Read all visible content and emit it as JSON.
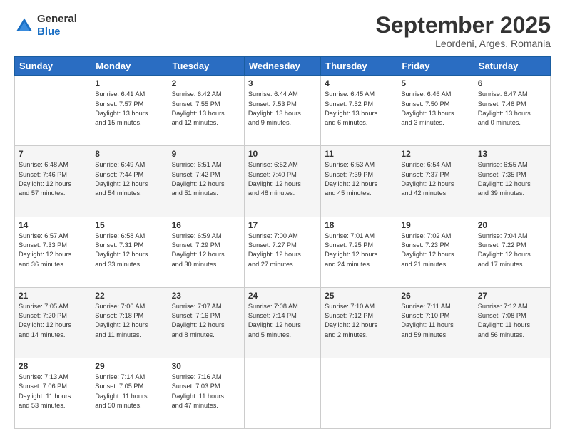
{
  "logo": {
    "general": "General",
    "blue": "Blue"
  },
  "header": {
    "title": "September 2025",
    "location": "Leordeni, Arges, Romania"
  },
  "days_of_week": [
    "Sunday",
    "Monday",
    "Tuesday",
    "Wednesday",
    "Thursday",
    "Friday",
    "Saturday"
  ],
  "weeks": [
    [
      {
        "day": "",
        "info": ""
      },
      {
        "day": "1",
        "info": "Sunrise: 6:41 AM\nSunset: 7:57 PM\nDaylight: 13 hours\nand 15 minutes."
      },
      {
        "day": "2",
        "info": "Sunrise: 6:42 AM\nSunset: 7:55 PM\nDaylight: 13 hours\nand 12 minutes."
      },
      {
        "day": "3",
        "info": "Sunrise: 6:44 AM\nSunset: 7:53 PM\nDaylight: 13 hours\nand 9 minutes."
      },
      {
        "day": "4",
        "info": "Sunrise: 6:45 AM\nSunset: 7:52 PM\nDaylight: 13 hours\nand 6 minutes."
      },
      {
        "day": "5",
        "info": "Sunrise: 6:46 AM\nSunset: 7:50 PM\nDaylight: 13 hours\nand 3 minutes."
      },
      {
        "day": "6",
        "info": "Sunrise: 6:47 AM\nSunset: 7:48 PM\nDaylight: 13 hours\nand 0 minutes."
      }
    ],
    [
      {
        "day": "7",
        "info": "Sunrise: 6:48 AM\nSunset: 7:46 PM\nDaylight: 12 hours\nand 57 minutes."
      },
      {
        "day": "8",
        "info": "Sunrise: 6:49 AM\nSunset: 7:44 PM\nDaylight: 12 hours\nand 54 minutes."
      },
      {
        "day": "9",
        "info": "Sunrise: 6:51 AM\nSunset: 7:42 PM\nDaylight: 12 hours\nand 51 minutes."
      },
      {
        "day": "10",
        "info": "Sunrise: 6:52 AM\nSunset: 7:40 PM\nDaylight: 12 hours\nand 48 minutes."
      },
      {
        "day": "11",
        "info": "Sunrise: 6:53 AM\nSunset: 7:39 PM\nDaylight: 12 hours\nand 45 minutes."
      },
      {
        "day": "12",
        "info": "Sunrise: 6:54 AM\nSunset: 7:37 PM\nDaylight: 12 hours\nand 42 minutes."
      },
      {
        "day": "13",
        "info": "Sunrise: 6:55 AM\nSunset: 7:35 PM\nDaylight: 12 hours\nand 39 minutes."
      }
    ],
    [
      {
        "day": "14",
        "info": "Sunrise: 6:57 AM\nSunset: 7:33 PM\nDaylight: 12 hours\nand 36 minutes."
      },
      {
        "day": "15",
        "info": "Sunrise: 6:58 AM\nSunset: 7:31 PM\nDaylight: 12 hours\nand 33 minutes."
      },
      {
        "day": "16",
        "info": "Sunrise: 6:59 AM\nSunset: 7:29 PM\nDaylight: 12 hours\nand 30 minutes."
      },
      {
        "day": "17",
        "info": "Sunrise: 7:00 AM\nSunset: 7:27 PM\nDaylight: 12 hours\nand 27 minutes."
      },
      {
        "day": "18",
        "info": "Sunrise: 7:01 AM\nSunset: 7:25 PM\nDaylight: 12 hours\nand 24 minutes."
      },
      {
        "day": "19",
        "info": "Sunrise: 7:02 AM\nSunset: 7:23 PM\nDaylight: 12 hours\nand 21 minutes."
      },
      {
        "day": "20",
        "info": "Sunrise: 7:04 AM\nSunset: 7:22 PM\nDaylight: 12 hours\nand 17 minutes."
      }
    ],
    [
      {
        "day": "21",
        "info": "Sunrise: 7:05 AM\nSunset: 7:20 PM\nDaylight: 12 hours\nand 14 minutes."
      },
      {
        "day": "22",
        "info": "Sunrise: 7:06 AM\nSunset: 7:18 PM\nDaylight: 12 hours\nand 11 minutes."
      },
      {
        "day": "23",
        "info": "Sunrise: 7:07 AM\nSunset: 7:16 PM\nDaylight: 12 hours\nand 8 minutes."
      },
      {
        "day": "24",
        "info": "Sunrise: 7:08 AM\nSunset: 7:14 PM\nDaylight: 12 hours\nand 5 minutes."
      },
      {
        "day": "25",
        "info": "Sunrise: 7:10 AM\nSunset: 7:12 PM\nDaylight: 12 hours\nand 2 minutes."
      },
      {
        "day": "26",
        "info": "Sunrise: 7:11 AM\nSunset: 7:10 PM\nDaylight: 11 hours\nand 59 minutes."
      },
      {
        "day": "27",
        "info": "Sunrise: 7:12 AM\nSunset: 7:08 PM\nDaylight: 11 hours\nand 56 minutes."
      }
    ],
    [
      {
        "day": "28",
        "info": "Sunrise: 7:13 AM\nSunset: 7:06 PM\nDaylight: 11 hours\nand 53 minutes."
      },
      {
        "day": "29",
        "info": "Sunrise: 7:14 AM\nSunset: 7:05 PM\nDaylight: 11 hours\nand 50 minutes."
      },
      {
        "day": "30",
        "info": "Sunrise: 7:16 AM\nSunset: 7:03 PM\nDaylight: 11 hours\nand 47 minutes."
      },
      {
        "day": "",
        "info": ""
      },
      {
        "day": "",
        "info": ""
      },
      {
        "day": "",
        "info": ""
      },
      {
        "day": "",
        "info": ""
      }
    ]
  ]
}
